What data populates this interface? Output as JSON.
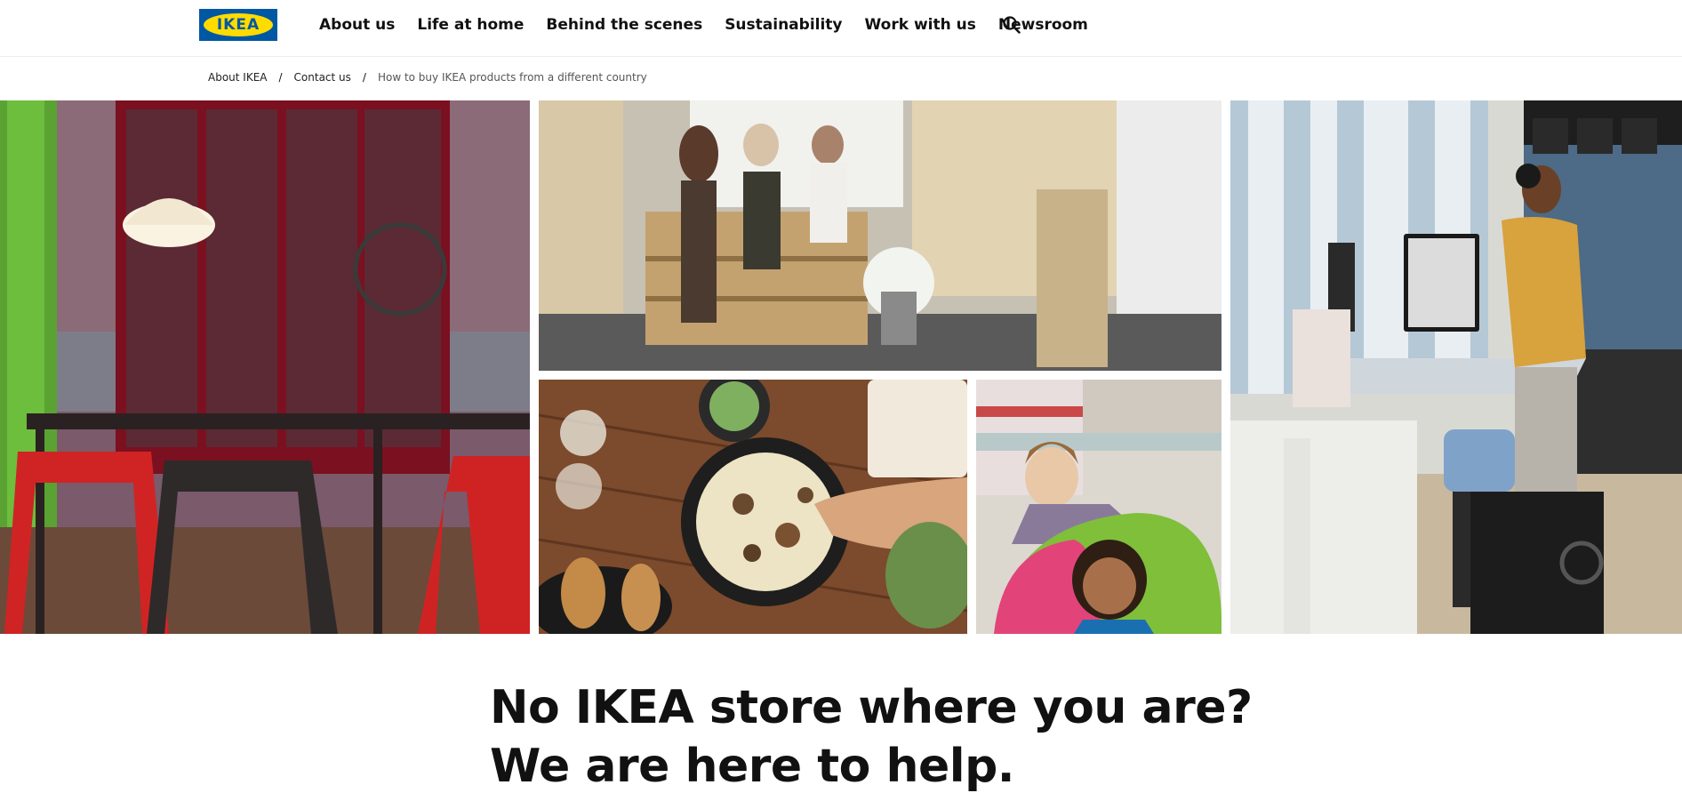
{
  "header": {
    "logo_text": "IKEA",
    "nav": [
      "About us",
      "Life at home",
      "Behind the scenes",
      "Sustainability",
      "Work with us",
      "Newsroom"
    ]
  },
  "breadcrumb": {
    "items": [
      "About IKEA",
      "Contact us"
    ],
    "current": "How to buy IKEA products from a different country",
    "separator": "/"
  },
  "hero": {
    "images": [
      "dining-room-photo",
      "grocery-shop-photo",
      "mushroom-dish-photo",
      "child-in-play-tunnel-photo",
      "standing-desk-office-photo"
    ]
  },
  "headline": {
    "line1": "No IKEA store where you are?",
    "line2": "We are here to help."
  },
  "colors": {
    "ikea_blue": "#0058a3",
    "ikea_yellow": "#ffdb00",
    "text": "#111111"
  }
}
